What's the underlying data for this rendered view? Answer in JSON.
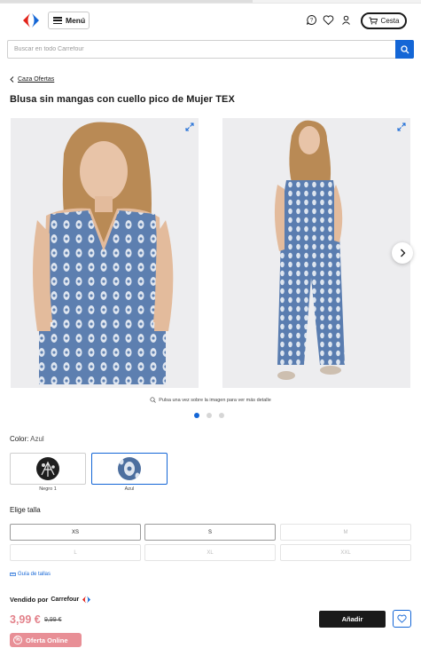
{
  "header": {
    "menu_label": "Menú",
    "cart_label": "Cesta",
    "logo_colors": {
      "red": "#e2231a",
      "blue": "#1466d6"
    }
  },
  "search": {
    "placeholder": "Buscar en todo Carrefour"
  },
  "breadcrumb": {
    "back_label": "Caza Ofertas"
  },
  "product": {
    "title": "Blusa sin mangas con cuello pico de Mujer TEX",
    "zoom_hint": "Pulsa una vez sobre la imagen para ver más detalle",
    "gallery_page": 1,
    "gallery_pages": 3,
    "color_label": "Color:",
    "color_value": "Azul",
    "colors": [
      {
        "name": "Negro 1",
        "selected": false
      },
      {
        "name": "Azul",
        "selected": true
      }
    ],
    "size_label": "Elige talla",
    "sizes": [
      {
        "label": "XS",
        "available": true
      },
      {
        "label": "S",
        "available": true
      },
      {
        "label": "M",
        "available": false
      },
      {
        "label": "L",
        "available": false
      },
      {
        "label": "XL",
        "available": false
      },
      {
        "label": "XXL",
        "available": false
      }
    ],
    "size_guide": "Guía de tallas",
    "sold_by_label": "Vendido por",
    "seller": "Carrefour",
    "price": "3,99 €",
    "old_price": "9,99 €",
    "add_label": "Añadir",
    "badge": "Oferta Online"
  },
  "colors": {
    "accent": "#1466d6",
    "price": "#e3828b",
    "badge": "#e88f96"
  }
}
